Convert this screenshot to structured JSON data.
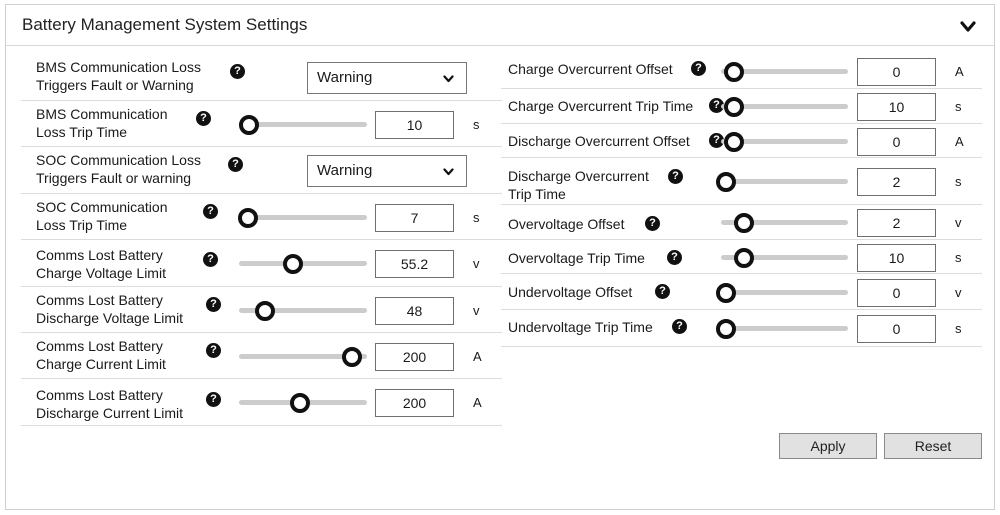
{
  "header": {
    "title": "Battery Management System Settings",
    "collapse_icon": "chevron-down-icon"
  },
  "left": [
    {
      "id": "bms-comm-loss-triggers",
      "label1": "BMS Communication Loss",
      "label2": "Triggers Fault or Warning",
      "type": "select",
      "value": "Warning"
    },
    {
      "id": "bms-comm-loss-trip-time",
      "label1": "BMS Communication",
      "label2": "Loss Trip Time",
      "type": "slider",
      "value": "10",
      "unit": "s",
      "level": 0.08
    },
    {
      "id": "soc-comm-loss-triggers",
      "label1": "SOC Communication Loss",
      "label2": "Triggers Fault or warning",
      "type": "select",
      "value": "Warning"
    },
    {
      "id": "soc-comm-loss-trip-time",
      "label1": "SOC Communication",
      "label2": "Loss Trip Time",
      "type": "slider",
      "value": "7",
      "unit": "s",
      "level": 0.07
    },
    {
      "id": "comms-lost-charge-voltage",
      "label1": "Comms Lost Battery",
      "label2": "Charge Voltage Limit",
      "type": "slider",
      "value": "55.2",
      "unit": "v",
      "level": 0.42
    },
    {
      "id": "comms-lost-discharge-voltage",
      "label1": "Comms Lost Battery",
      "label2": "Discharge Voltage Limit",
      "type": "slider",
      "value": "48",
      "unit": "v",
      "level": 0.2
    },
    {
      "id": "comms-lost-charge-current",
      "label1": "Comms Lost Battery",
      "label2": "Charge Current Limit",
      "type": "slider",
      "value": "200",
      "unit": "A",
      "level": 0.88
    },
    {
      "id": "comms-lost-discharge-current",
      "label1": "Comms Lost Battery",
      "label2": "Discharge Current Limit",
      "type": "slider",
      "value": "200",
      "unit": "A",
      "level": 0.48
    }
  ],
  "right": [
    {
      "id": "charge-overcurrent-offset",
      "label1": "Charge Overcurrent Offset",
      "label2": "",
      "value": "0",
      "unit": "A",
      "level": 0.1
    },
    {
      "id": "charge-overcurrent-trip-time",
      "label1": "Charge Overcurrent Trip Time",
      "label2": "",
      "value": "10",
      "unit": "s",
      "level": 0.1
    },
    {
      "id": "discharge-overcurrent-offset",
      "label1": "Discharge Overcurrent Offset",
      "label2": "",
      "value": "0",
      "unit": "A",
      "level": 0.1
    },
    {
      "id": "discharge-overcurrent-trip-time",
      "label1": "Discharge Overcurrent",
      "label2": "Trip Time",
      "value": "2",
      "unit": "s",
      "level": 0.04
    },
    {
      "id": "overvoltage-offset",
      "label1": "Overvoltage Offset",
      "label2": "",
      "value": "2",
      "unit": "v",
      "level": 0.18
    },
    {
      "id": "overvoltage-trip-time",
      "label1": "Overvoltage Trip Time",
      "label2": "",
      "value": "10",
      "unit": "s",
      "level": 0.18
    },
    {
      "id": "undervoltage-offset",
      "label1": "Undervoltage Offset",
      "label2": "",
      "value": "0",
      "unit": "v",
      "level": 0.04
    },
    {
      "id": "undervoltage-trip-time",
      "label1": "Undervoltage Trip Time",
      "label2": "",
      "value": "0",
      "unit": "s",
      "level": 0.04
    }
  ],
  "buttons": {
    "apply": "Apply",
    "reset": "Reset"
  },
  "icons": {
    "help": "help-icon",
    "dropdown": "chevron-down-icon"
  },
  "colors": {
    "track": "#cccccc",
    "knob_border": "#111111",
    "button_bg": "#e1e1e1"
  }
}
